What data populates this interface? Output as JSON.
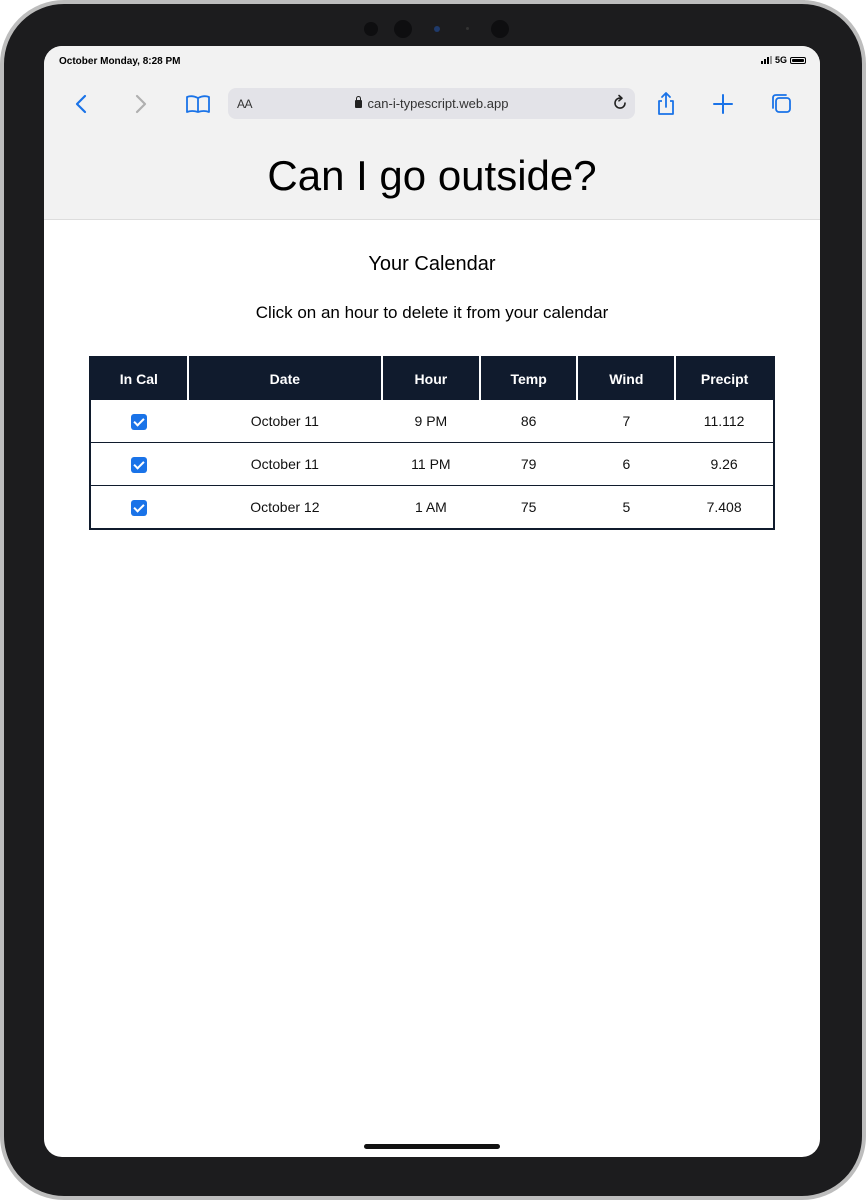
{
  "status": {
    "datetime": "October Monday, 8:28 PM",
    "network": "5G"
  },
  "browser": {
    "text_size_label": "AA",
    "url": "can-i-typescript.web.app"
  },
  "site": {
    "title": "Can I go outside?"
  },
  "calendar": {
    "heading": "Your Calendar",
    "instruction": "Click on an hour to delete it from your calendar",
    "columns": [
      "In Cal",
      "Date",
      "Hour",
      "Temp",
      "Wind",
      "Precipt"
    ],
    "rows": [
      {
        "in_cal": true,
        "date": "October 11",
        "hour": "9 PM",
        "temp": "86",
        "wind": "7",
        "precipt": "11.112"
      },
      {
        "in_cal": true,
        "date": "October 11",
        "hour": "11 PM",
        "temp": "79",
        "wind": "6",
        "precipt": "9.26"
      },
      {
        "in_cal": true,
        "date": "October 12",
        "hour": "1 AM",
        "temp": "75",
        "wind": "5",
        "precipt": "7.408"
      }
    ]
  },
  "colors": {
    "accent": "#1a73e8",
    "table_header": "#101b2d"
  },
  "icons": [
    "back-icon",
    "forward-icon",
    "bookmarks-icon",
    "lock-icon",
    "reload-icon",
    "share-icon",
    "new-tab-icon",
    "tabs-icon"
  ]
}
